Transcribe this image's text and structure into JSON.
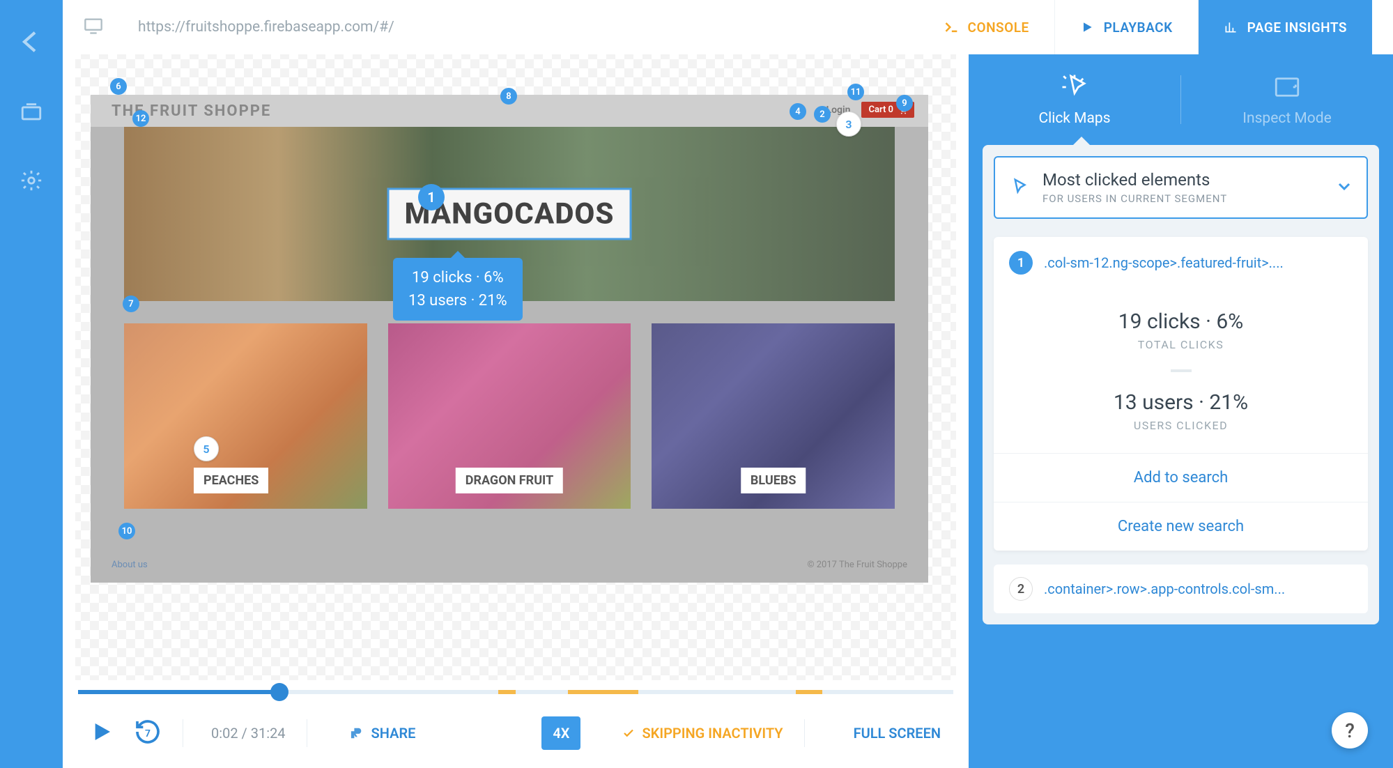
{
  "header": {
    "url": "https://fruitshoppe.firebaseapp.com/#/",
    "console": "CONSOLE",
    "playback": "PLAYBACK",
    "insights": "PAGE INSIGHTS"
  },
  "site": {
    "title": "THE FRUIT SHOPPE",
    "login": "Login",
    "cart": "Cart 0",
    "hero": "MANGOCADOS",
    "tiles": {
      "peaches": "PEACHES",
      "dragon": "DRAGON FRUIT",
      "bluebs": "BLUEBS"
    },
    "about": "About us",
    "copyright": "© 2017 The Fruit Shoppe"
  },
  "badges": {
    "b1": "1",
    "b2": "2",
    "b3": "3",
    "b4": "4",
    "b5": "5",
    "b6": "6",
    "b7": "7",
    "b8": "8",
    "b9": "9",
    "b10": "10",
    "b11": "11",
    "b12": "12"
  },
  "tooltip": {
    "line1": "19 clicks · 6%",
    "line2": "13 users · 21%"
  },
  "playback": {
    "time": "0:02 / 31:24",
    "share": "SHARE",
    "speed": "4X",
    "skipping": "SKIPPING INACTIVITY",
    "fullscreen": "FULL SCREEN",
    "rewind_num": "7"
  },
  "panel": {
    "tab_clickmaps": "Click Maps",
    "tab_inspect": "Inspect Mode",
    "segment_title": "Most clicked elements",
    "segment_sub": "FOR USERS IN CURRENT SEGMENT",
    "elements": [
      {
        "rank": "1",
        "selector": ".col-sm-12.ng-scope>.featured-fruit>...."
      },
      {
        "rank": "2",
        "selector": ".container>.row>.app-controls.col-sm..."
      }
    ],
    "stat1": "19 clicks · 6%",
    "stat1_sub": "TOTAL CLICKS",
    "stat2": "13 users · 21%",
    "stat2_sub": "USERS CLICKED",
    "add_search": "Add to search",
    "create_search": "Create new search"
  },
  "help": "?"
}
